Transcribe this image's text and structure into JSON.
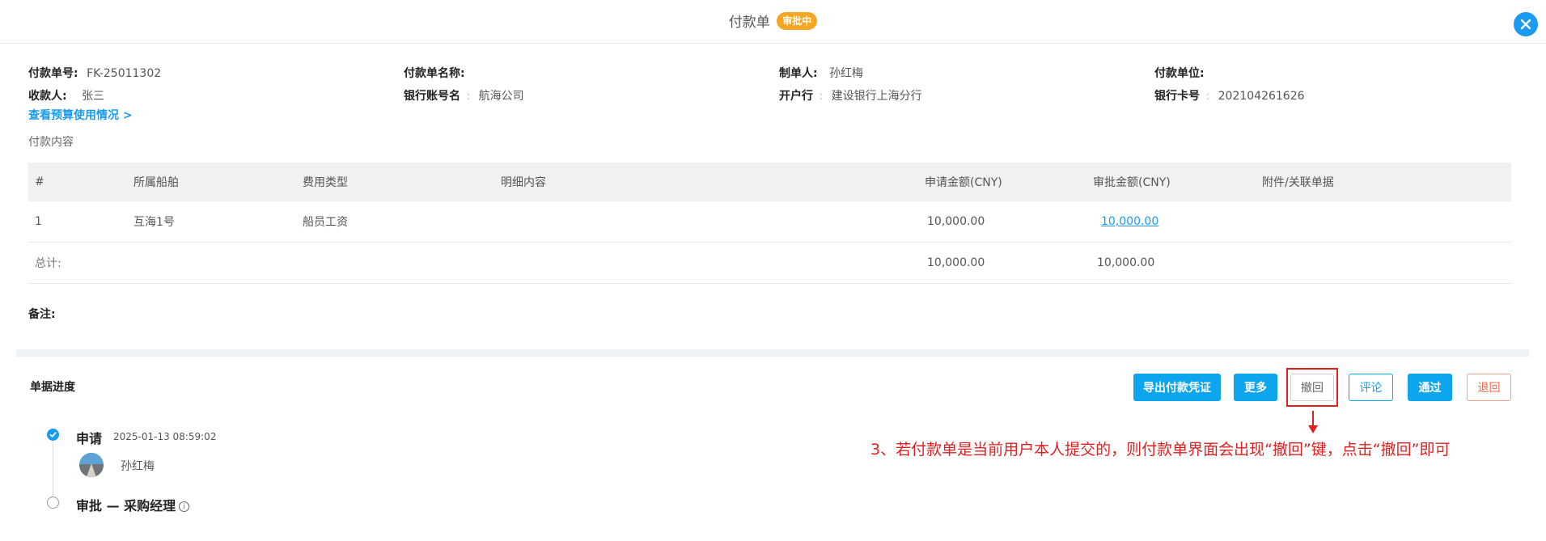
{
  "header": {
    "title": "付款单",
    "status_badge": "审批中",
    "close_icon": "close-icon"
  },
  "info": {
    "payment_no_label": "付款单号:",
    "payment_no": "FK-25011302",
    "payment_name_label": "付款单名称:",
    "payment_name": "",
    "maker_label": "制单人:",
    "maker": "孙红梅",
    "payer_unit_label": "付款单位:",
    "payer_unit": "",
    "payee_label": "收款人:",
    "payee": "张三",
    "account_name_label": "银行账号名",
    "account_name": "航海公司",
    "bank_label": "开户行",
    "bank": "建设银行上海分行",
    "card_no_label": "银行卡号",
    "card_no": "202104261626",
    "colon": ":"
  },
  "budget_link": "查看预算使用情况 >",
  "content_section_label": "付款内容",
  "table": {
    "headers": [
      "#",
      "所属船舶",
      "费用类型",
      "明细内容",
      "申请金额(CNY)",
      "审批金额(CNY)",
      "附件/关联单据"
    ],
    "rows": [
      {
        "index": "1",
        "ship": "互海1号",
        "fee_type": "船员工资",
        "detail": "",
        "apply_amount": "10,000.00",
        "approve_amount": "10,000.00",
        "attachment": ""
      }
    ],
    "total": {
      "label": "总计:",
      "apply_amount": "10,000.00",
      "approve_amount": "10,000.00"
    }
  },
  "remark_label": "备注:",
  "progress": {
    "title": "单据进度",
    "steps": [
      {
        "title": "申请",
        "time": "2025-01-13 08:59:02",
        "user": "孙红梅",
        "status": "done"
      },
      {
        "title": "审批 — 采购经理",
        "status": "pending",
        "info_icon": "ⓘ"
      }
    ]
  },
  "actions": {
    "export": "导出付款凭证",
    "more": "更多",
    "withdraw": "撤回",
    "comment": "评论",
    "approve": "通过",
    "reject": "退回"
  },
  "annotation": "3、若付款单是当前用户本人提交的，则付款单界面会出现“撤回”键，点击“撤回”即可",
  "colors": {
    "accent": "#0ea5ef",
    "badge": "#f5a623",
    "annotation_red": "#e02020",
    "reject_red": "#f06a4d"
  }
}
